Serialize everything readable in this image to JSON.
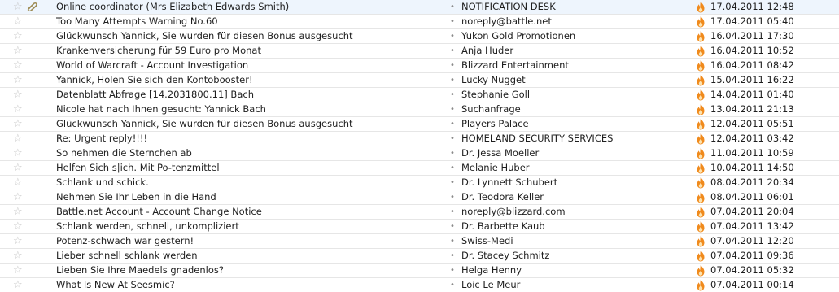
{
  "messages": [
    {
      "subject": "Online coordinator (Mrs Elizabeth Edwards Smith)",
      "sender": "NOTIFICATION DESK",
      "date": "17.04.2011 12:48",
      "starred": false,
      "attachment": true,
      "junk": true
    },
    {
      "subject": "Too Many Attempts Warning No.60",
      "sender": "noreply@battle.net",
      "date": "17.04.2011 05:40",
      "starred": false,
      "attachment": false,
      "junk": true
    },
    {
      "subject": "Glückwunsch Yannick, Sie wurden für diesen Bonus ausgesucht",
      "sender": "Yukon Gold Promotionen",
      "date": "16.04.2011 17:30",
      "starred": false,
      "attachment": false,
      "junk": true
    },
    {
      "subject": "Krankenversicherung für 59 Euro pro Monat",
      "sender": "Anja Huder",
      "date": "16.04.2011 10:52",
      "starred": false,
      "attachment": false,
      "junk": true
    },
    {
      "subject": "World of Warcraft - Account Investigation",
      "sender": "Blizzard Entertainment",
      "date": "16.04.2011 08:42",
      "starred": false,
      "attachment": false,
      "junk": true
    },
    {
      "subject": "Yannick, Holen Sie sich den Kontobooster!",
      "sender": "Lucky Nugget",
      "date": "15.04.2011 16:22",
      "starred": false,
      "attachment": false,
      "junk": true
    },
    {
      "subject": "Datenblatt Abfrage [14.2031800.11] Bach",
      "sender": "Stephanie Goll",
      "date": "14.04.2011 01:40",
      "starred": false,
      "attachment": false,
      "junk": true
    },
    {
      "subject": "Nicole hat nach Ihnen gesucht: Yannick Bach",
      "sender": "Suchanfrage",
      "date": "13.04.2011 21:13",
      "starred": false,
      "attachment": false,
      "junk": true
    },
    {
      "subject": "Glückwunsch Yannick, Sie wurden für diesen Bonus ausgesucht",
      "sender": "Players Palace",
      "date": "12.04.2011 05:51",
      "starred": false,
      "attachment": false,
      "junk": true
    },
    {
      "subject": "Re: Urgent reply!!!!",
      "sender": "HOMELAND SECURITY SERVICES",
      "date": "12.04.2011 03:42",
      "starred": false,
      "attachment": false,
      "junk": true
    },
    {
      "subject": "So nehmen die Sternchen ab",
      "sender": "Dr. Jessa Moeller",
      "date": "11.04.2011 10:59",
      "starred": false,
      "attachment": false,
      "junk": true
    },
    {
      "subject": "Helfen Sich s|ich. Mit Po-tenzmittel",
      "sender": "Melanie Huber",
      "date": "10.04.2011 14:50",
      "starred": false,
      "attachment": false,
      "junk": true
    },
    {
      "subject": "Schlank und schick.",
      "sender": "Dr. Lynnett Schubert",
      "date": "08.04.2011 20:34",
      "starred": false,
      "attachment": false,
      "junk": true
    },
    {
      "subject": "Nehmen Sie Ihr Leben in die Hand",
      "sender": "Dr. Teodora Keller",
      "date": "08.04.2011 06:01",
      "starred": false,
      "attachment": false,
      "junk": true
    },
    {
      "subject": "Battle.net Account - Account Change Notice",
      "sender": "noreply@blizzard.com",
      "date": "07.04.2011 20:04",
      "starred": false,
      "attachment": false,
      "junk": true
    },
    {
      "subject": "Schlank werden, schnell, unkompliziert",
      "sender": "Dr. Barbette Kaub",
      "date": "07.04.2011 13:42",
      "starred": false,
      "attachment": false,
      "junk": true
    },
    {
      "subject": "Potenz-schwach war gestern!",
      "sender": "Swiss-Medi",
      "date": "07.04.2011 12:20",
      "starred": false,
      "attachment": false,
      "junk": true
    },
    {
      "subject": "Lieber schnell schlank werden",
      "sender": "Dr. Stacey Schmitz",
      "date": "07.04.2011 09:36",
      "starred": false,
      "attachment": false,
      "junk": true
    },
    {
      "subject": "Lieben Sie Ihre Maedels gnadenlos?",
      "sender": "Helga Henny",
      "date": "07.04.2011 05:32",
      "starred": false,
      "attachment": false,
      "junk": true
    },
    {
      "subject": "What Is New At Seesmic?",
      "sender": "Loic Le Meur",
      "date": "07.04.2011 00:14",
      "starred": false,
      "attachment": false,
      "junk": true
    }
  ],
  "icons": {
    "star": "star-outline-icon",
    "attachment": "paperclip-icon",
    "junk": "junk-flame-icon",
    "read_status": "read-dot-icon"
  },
  "colors": {
    "flame_outer": "#f08a1c",
    "flame_inner": "#fde3b0",
    "star": "#c4c4c4",
    "row_divider": "#e6e6e6"
  }
}
